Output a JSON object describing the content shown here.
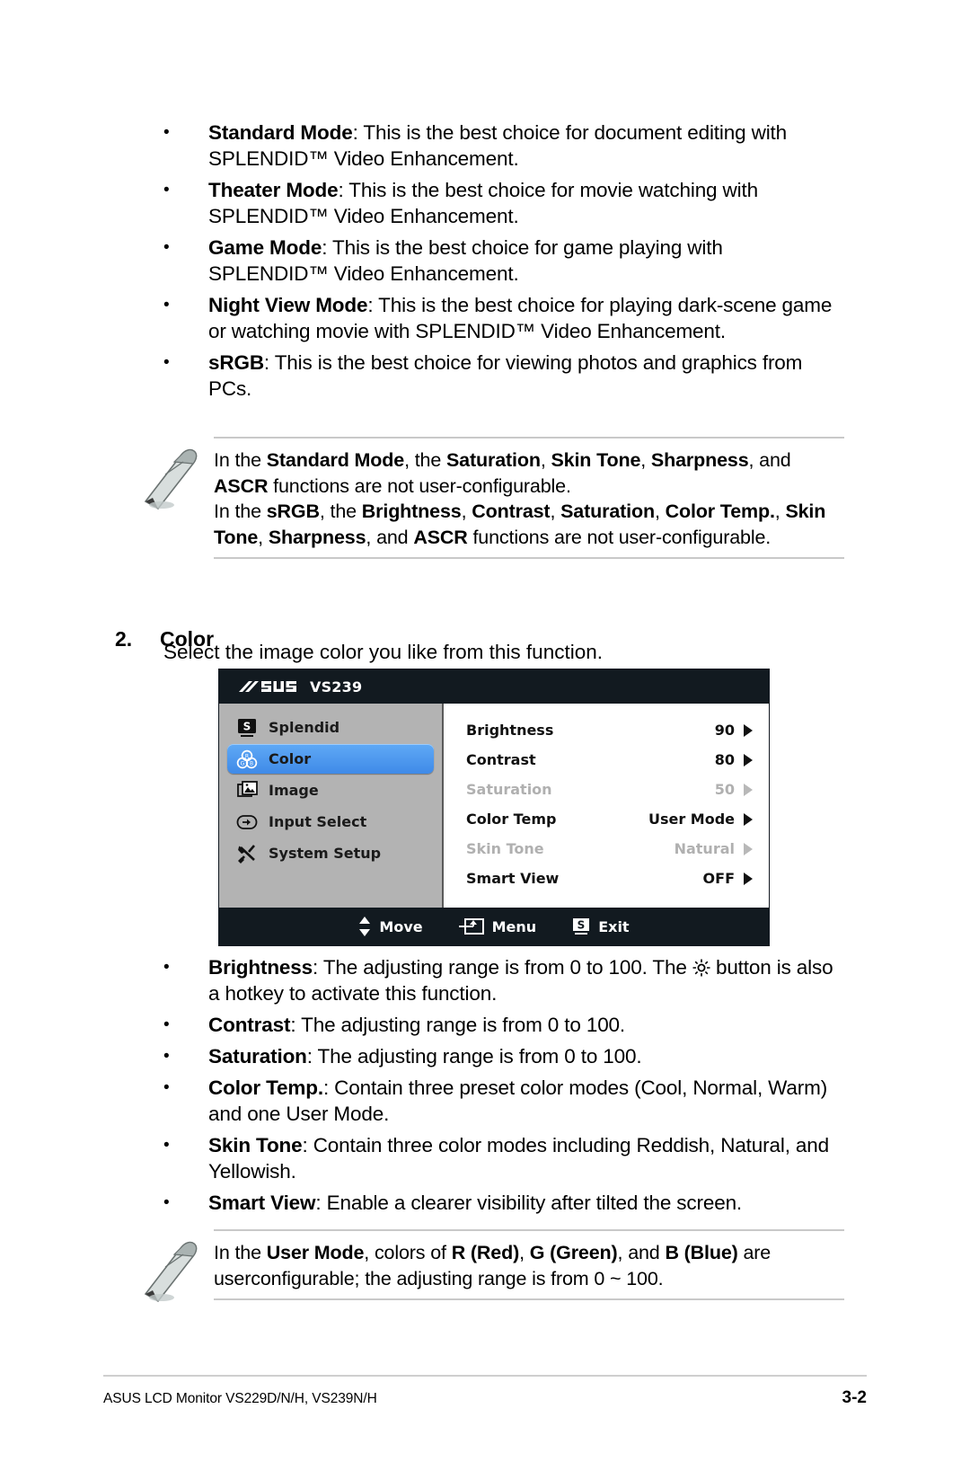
{
  "splendid_modes": [
    {
      "bullet": "•",
      "term": "Standard Mode",
      "rest": ": This is the best choice for document editing with SPLENDID™ Video Enhancement."
    },
    {
      "bullet": "•",
      "term": "Theater Mode",
      "rest": ": This is the best choice for movie watching with SPLENDID™ Video Enhancement."
    },
    {
      "bullet": "•",
      "term": "Game Mode",
      "rest": ": This is the best choice for game playing with SPLENDID™ Video Enhancement."
    },
    {
      "bullet": "•",
      "term": "Night View Mode",
      "rest": ": This is the best choice for playing dark-scene game or watching movie with SPLENDID™ Video Enhancement."
    },
    {
      "bullet": "•",
      "term": "sRGB",
      "rest": ": This is the best choice for viewing photos and graphics from PCs."
    }
  ],
  "note_top": {
    "icon": "pencil-note-icon",
    "line1_a": "In the ",
    "line1_b": "Standard Mode",
    "line1_c": ", the ",
    "line1_d": "Saturation",
    "line1_e": ",  ",
    "line1_f": "Skin Tone",
    "line1_g": ", ",
    "line1_h": "Sharpness",
    "line1_i": ", and ",
    "line1_j": "ASCR",
    "line1_k": " functions are not user-configurable.",
    "line2_a": "In the ",
    "line2_b": "sRGB",
    "line2_c": ", the ",
    "line2_d": "Brightness",
    "line2_e": ", ",
    "line2_f": "Contrast",
    "line2_g": ", ",
    "line2_h": "Saturation",
    "line2_i": ", ",
    "line2_j": "Color Temp.",
    "line2_k": ", ",
    "line2_l": "Skin Tone",
    "line2_m": ", ",
    "line2_n": "Sharpness",
    "line2_o": ", and ",
    "line2_p": "ASCR",
    "line2_q": " functions are not user-configurable."
  },
  "section": {
    "number": "2.",
    "title": "Color",
    "subtitle": "Select the image color you like from this function."
  },
  "osd": {
    "brand": "ASUS",
    "model": "VS239",
    "sidebar": [
      {
        "label": "Splendid",
        "icon": "splendid-s-icon",
        "selected": false
      },
      {
        "label": "Color",
        "icon": "color-palette-icon",
        "selected": true
      },
      {
        "label": "Image",
        "icon": "image-frames-icon",
        "selected": false
      },
      {
        "label": "Input Select",
        "icon": "input-arrow-icon",
        "selected": false
      },
      {
        "label": "System Setup",
        "icon": "tools-icon",
        "selected": false
      }
    ],
    "rows": [
      {
        "label": "Brightness",
        "value": "90",
        "disabled": false
      },
      {
        "label": "Contrast",
        "value": "80",
        "disabled": false
      },
      {
        "label": "Saturation",
        "value": "50",
        "disabled": true
      },
      {
        "label": "Color Temp",
        "value": "User Mode",
        "disabled": false
      },
      {
        "label": "Skin Tone",
        "value": "Natural",
        "disabled": true
      },
      {
        "label": "Smart View",
        "value": "OFF",
        "disabled": false
      }
    ],
    "footer": [
      {
        "label": "Move",
        "icon": "up-down-arrows-icon"
      },
      {
        "label": "Menu",
        "icon": "enter-menu-icon"
      },
      {
        "label": "Exit",
        "icon": "splendid-s-icon"
      }
    ],
    "colors": {
      "header_bg": "#121a20",
      "sidebar_bg": "#b3b3b3",
      "highlight": "#4a96ef",
      "disabled_text": "#b0b0b0"
    }
  },
  "color_options": [
    {
      "bullet": "•",
      "term": "Brightness",
      "rest_a": ": The adjusting range is from 0 to 100. The ",
      "glyph": "brightness-sun-icon",
      "rest_b": " button is also a hotkey to activate this function."
    },
    {
      "bullet": "•",
      "term": "Contrast",
      "rest_a": ": The adjusting range is from 0 to 100.",
      "glyph": "",
      "rest_b": ""
    },
    {
      "bullet": "•",
      "term": "Saturation",
      "rest_a": ": The adjusting range is from 0 to 100.",
      "glyph": "",
      "rest_b": ""
    },
    {
      "bullet": "•",
      "term": "Color Temp.",
      "rest_a": ": Contain three preset color modes (Cool, Normal, Warm) and one User Mode.",
      "glyph": "",
      "rest_b": ""
    },
    {
      "bullet": "•",
      "term": "Skin Tone",
      "rest_a": ": Contain three color modes including Reddish, Natural, and Yellowish.",
      "glyph": "",
      "rest_b": ""
    },
    {
      "bullet": "•",
      "term": "Smart View",
      "rest_a": ": Enable a clearer visibility after tilted the screen.",
      "glyph": "",
      "rest_b": ""
    }
  ],
  "note_bottom": {
    "icon": "pencil-note-icon",
    "a": "In the ",
    "b": "User Mode",
    "c": ", colors of ",
    "d": "R (Red)",
    "e": ", ",
    "f": "G (Green)",
    "g": ", and ",
    "h": "B (Blue)",
    "i": " are userconfigurable; the adjusting range is from 0 ~ 100."
  },
  "footer": {
    "left": "ASUS LCD Monitor VS229D/N/H, VS239N/H",
    "page": "3-2"
  }
}
